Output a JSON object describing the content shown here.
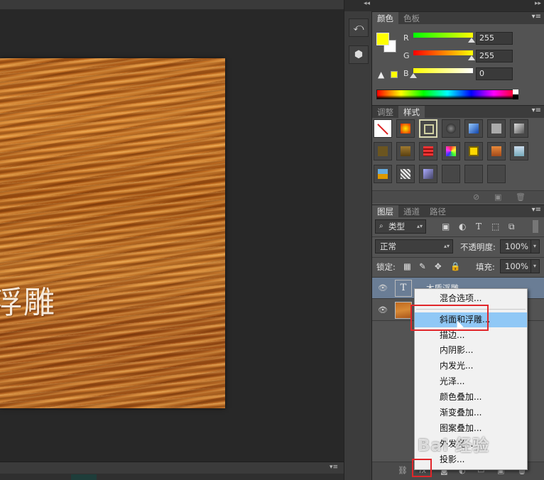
{
  "canvas": {
    "text": "浮雕"
  },
  "color_panel": {
    "tabs": [
      "颜色",
      "色板"
    ],
    "channels": [
      {
        "label": "R",
        "value": "255"
      },
      {
        "label": "G",
        "value": "255"
      },
      {
        "label": "B",
        "value": "0"
      }
    ],
    "foreground_color": "#ffff00",
    "background_color": "#ffffff"
  },
  "styles_panel": {
    "tabs": [
      "调整",
      "样式"
    ]
  },
  "layers_panel": {
    "tabs": [
      "图层",
      "通道",
      "路径"
    ],
    "filter_kind": "类型",
    "blend_mode": "正常",
    "opacity_label": "不透明度:",
    "opacity_value": "100%",
    "lock_label": "锁定:",
    "fill_label": "填充:",
    "fill_value": "100%",
    "layers": [
      {
        "name": "木质浮雕",
        "type": "text"
      },
      {
        "name": "",
        "type": "image"
      }
    ]
  },
  "context_menu": {
    "items": [
      "混合选项...",
      "斜面和浮雕...",
      "描边...",
      "内阴影...",
      "内发光...",
      "光泽...",
      "颜色叠加...",
      "渐变叠加...",
      "图案叠加...",
      "外发光...",
      "投影..."
    ],
    "highlighted_index": 1
  },
  "watermark": "Bai 经验",
  "icons": {
    "panel_menu": "panel-menu-icon",
    "history": "history-icon",
    "3d": "3d-icon",
    "eye": "eye-icon",
    "fx": "fx-icon"
  }
}
